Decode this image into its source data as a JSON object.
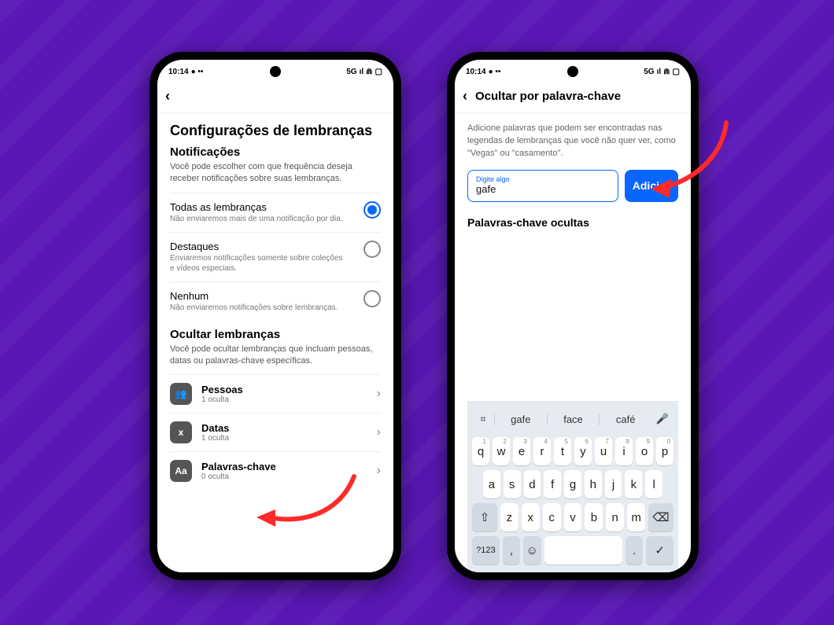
{
  "status": {
    "time": "10:14",
    "net": "5G",
    "signal": "ıl",
    "wifi": "⋒",
    "battery": "▢"
  },
  "left": {
    "title": "Configurações de lembranças",
    "sec1_h": "Notificações",
    "sec1_sub": "Você pode escolher com que frequência deseja receber notificações sobre suas lembranças.",
    "opt": [
      {
        "t": "Todas as lembranças",
        "s": "Não enviaremos mais de uma notificação por dia."
      },
      {
        "t": "Destaques",
        "s": "Enviaremos notificações somente sobre coleções e vídeos especiais."
      },
      {
        "t": "Nenhum",
        "s": "Não enviaremos notificações sobre lembranças."
      }
    ],
    "sec2_h": "Ocultar lembranças",
    "sec2_sub": "Você pode ocultar lembranças que incluam pessoas, datas ou palavras-chave específicas.",
    "items": [
      {
        "icon": "👥",
        "t": "Pessoas",
        "s": "1 oculta"
      },
      {
        "icon": "x",
        "t": "Datas",
        "s": "1 oculta"
      },
      {
        "icon": "Aa",
        "t": "Palavras-chave",
        "s": "0 oculta"
      }
    ]
  },
  "right": {
    "title": "Ocultar por palavra-chave",
    "desc": "Adicione palavras que podem ser encontradas nas legendas de lembranças que você não quer ver, como \"Vegas\" ou \"casamento\".",
    "field_label": "Digite algo",
    "field_value": "gafe",
    "add": "Adici…",
    "hidden_h": "Palavras-chave ocultas",
    "sugs": [
      "gafe",
      "face",
      "café"
    ],
    "rows": [
      [
        "q",
        "w",
        "e",
        "r",
        "t",
        "y",
        "u",
        "i",
        "o",
        "p"
      ],
      [
        "a",
        "s",
        "d",
        "f",
        "g",
        "h",
        "j",
        "k",
        "l"
      ],
      [
        "z",
        "x",
        "c",
        "v",
        "b",
        "n",
        "m"
      ]
    ],
    "nums": [
      "1",
      "2",
      "3",
      "4",
      "5",
      "6",
      "7",
      "8",
      "9",
      "0"
    ],
    "shift": "⇧",
    "bsp": "⌫",
    "numkey": "?123",
    "comma": ",",
    "emoji": "☺",
    "period": ".",
    "enter": "✓"
  }
}
